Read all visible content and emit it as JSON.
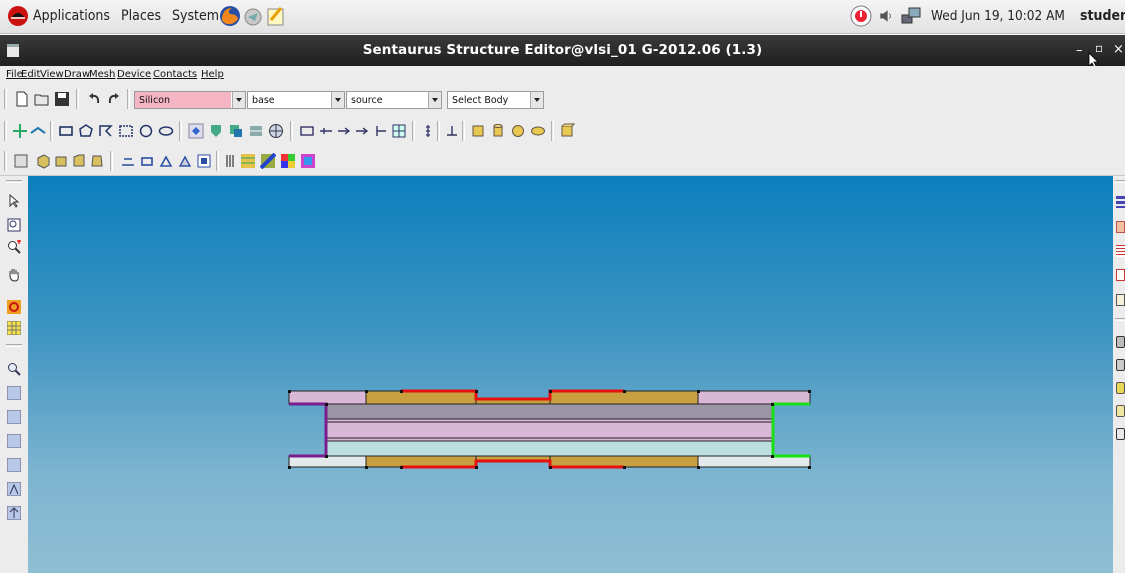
{
  "panel": {
    "menus": [
      "Applications",
      "Places",
      "System"
    ],
    "clock": "Wed Jun 19, 10:02 AM",
    "user": "student"
  },
  "window": {
    "title": "Sentaurus Structure Editor@vlsi_01 G-2012.06 (1.3)",
    "controls": [
      "–",
      "▫",
      "×"
    ]
  },
  "menubar": [
    "File",
    "Edit",
    "View",
    "Draw",
    "Mesh",
    "Device",
    "Contacts",
    "Help"
  ],
  "toolbar_selects": {
    "material": "Silicon",
    "region": "base",
    "contact": "source",
    "select_mode": "Select Body"
  },
  "colors": {
    "material_field_bg": "#f4b4c4",
    "canvas_top": "#0b7fbd",
    "canvas_bottom": "#8ebfd3",
    "contact_red": "#e8110f",
    "contact_purple": "#7a1d8f",
    "contact_green": "#16e016",
    "oxide_gold": "#c8a040",
    "pink_region": "#d9b7d6",
    "gray_region": "#9b96a5",
    "teal_region": "#bcdede",
    "light_region": "#e4eaeb"
  },
  "icons": {
    "left_sidebar": [
      "select-arrow-icon",
      "zoom-box-icon",
      "zoom-in-icon",
      "pan-hand-icon",
      "rotate-icon",
      "grid-icon",
      "separator",
      "magnify-icon",
      "view-xy-icon",
      "view-neg-xy-icon",
      "view-xz-icon",
      "view-yz-icon",
      "axis-icon",
      "up-arrow-icon"
    ],
    "right_sidebar": [
      "layers-icon",
      "truncation-icon",
      "table-icon",
      "contact-set-icon",
      "doping-icon",
      "separator",
      "cylinder-icon",
      "cylinder-icon",
      "cylinder-icon",
      "cylinder-icon",
      "cylinder-icon"
    ]
  }
}
